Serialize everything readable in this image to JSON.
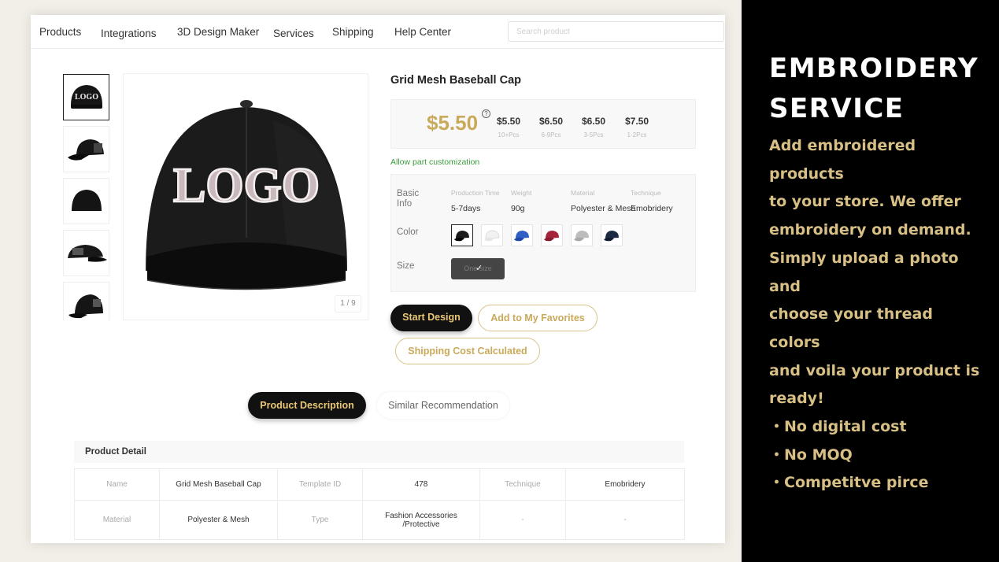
{
  "nav": {
    "items": [
      "Products",
      "Integrations",
      "3D Design Maker",
      "Services",
      "Shipping",
      "Help Center"
    ],
    "search_placeholder": "Search product"
  },
  "gallery": {
    "thumbnails": [
      "logo-front-cap",
      "side-view-cap",
      "back-view-cap",
      "profile-view-cap",
      "rear-angle-cap"
    ],
    "main_image_text": "LOGO",
    "counter": "1 / 9"
  },
  "product": {
    "title": "Grid Mesh Baseball Cap",
    "price": "$5.50",
    "price_help": "?",
    "tiers": [
      {
        "price": "$5.50",
        "qty": "10+Pcs"
      },
      {
        "price": "$6.50",
        "qty": "6-9Pcs"
      },
      {
        "price": "$6.50",
        "qty": "3-5Pcs"
      },
      {
        "price": "$7.50",
        "qty": "1-2Pcs"
      }
    ],
    "allow_customization": "Allow part customization"
  },
  "specs": {
    "basic_info_label": "Basic Info",
    "headers": [
      "Production Time",
      "Weight",
      "Material",
      "Technique"
    ],
    "values": [
      "5-7days",
      "90g",
      "Polyester & Mesh",
      "Emobridery"
    ],
    "color_label": "Color",
    "colors": [
      {
        "name": "black",
        "hex": "#1a1a1a"
      },
      {
        "name": "white",
        "hex": "#f2f2f2"
      },
      {
        "name": "royal-blue",
        "hex": "#2f5fc4"
      },
      {
        "name": "burgundy",
        "hex": "#a3243b"
      },
      {
        "name": "light-grey",
        "hex": "#bdbdbd"
      },
      {
        "name": "navy",
        "hex": "#1e2a44"
      }
    ],
    "size_label": "Size",
    "size_value": "One size"
  },
  "actions": {
    "start_design": "Start Design",
    "favorites": "Add to My Favorites",
    "shipping": "Shipping Cost Calculated"
  },
  "tabs": {
    "description": "Product Description",
    "similar": "Similar Recommendation"
  },
  "detail": {
    "heading": "Product Detail",
    "rows": [
      [
        "Name",
        "Grid Mesh Baseball Cap",
        "Template ID",
        "478",
        "Technique",
        "Emobridery"
      ],
      [
        "Material",
        "Polyester & Mesh",
        "Type",
        "Fashion Accessories /Protective",
        "-",
        "-"
      ]
    ]
  },
  "promo": {
    "title_line1": "EMBROIDERY",
    "title_line2": "SERVICE",
    "body_lines": [
      "Add embroidered products",
      "to your store. We offer",
      "embroidery on demand.",
      "Simply upload a photo and",
      "choose your thread colors",
      "and voila your product is",
      "ready!"
    ],
    "bullets": [
      "・No digital cost",
      "・No MOQ",
      "・Competitve pirce"
    ]
  },
  "colors": {
    "gold": "#c9a95a",
    "promo_text": "#d7bf85",
    "dark_button": "#111111",
    "green_link": "#3a9c3a"
  }
}
